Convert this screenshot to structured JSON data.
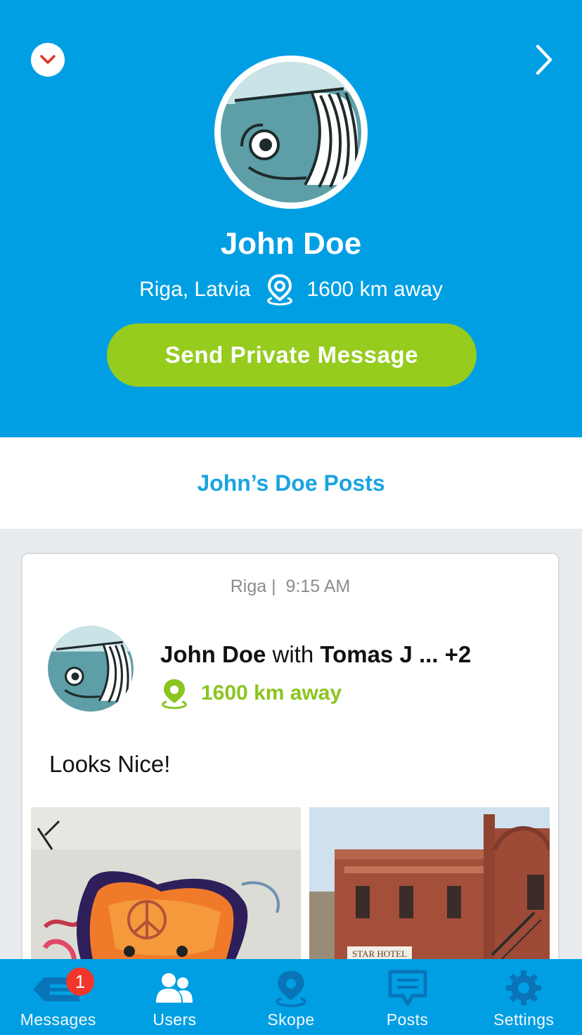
{
  "header": {
    "name": "John Doe",
    "location": "Riga, Latvia",
    "distance": "1600 km away",
    "send_button": "Send Private Message"
  },
  "posts_section": {
    "title": "John’s Doe Posts"
  },
  "post": {
    "city": "Riga |",
    "time": "9:15 AM",
    "author": "John Doe",
    "with_word": "with",
    "tagged": "Tomas J ... +2",
    "distance": "1600 km away",
    "text": "Looks Nice!"
  },
  "tabbar": {
    "tabs": [
      {
        "label": "Messages",
        "icon": "messages-icon",
        "badge": "1"
      },
      {
        "label": "Users",
        "icon": "users-icon"
      },
      {
        "label": "Skope",
        "icon": "location-pin-icon"
      },
      {
        "label": "Posts",
        "icon": "chat-bubble-icon"
      },
      {
        "label": "Settings",
        "icon": "gear-icon"
      }
    ]
  },
  "colors": {
    "header_bg": "#009fe3",
    "accent_green": "#95cc1e",
    "badge_red": "#f2352a",
    "link_blue": "#1aa4e0"
  }
}
